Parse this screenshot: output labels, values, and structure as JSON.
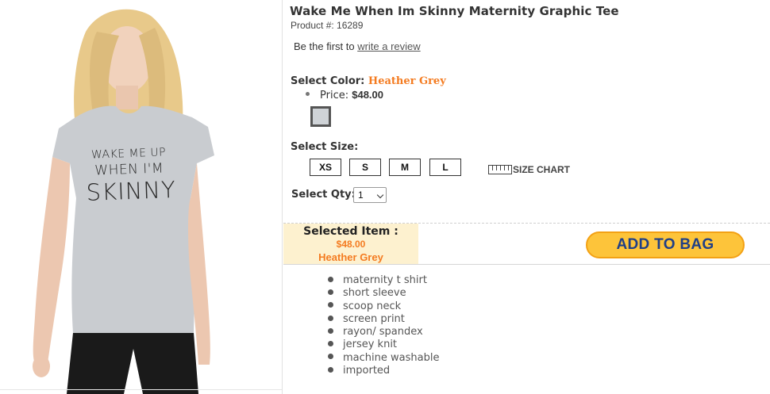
{
  "product": {
    "title": "Wake Me When Im Skinny Maternity Graphic Tee",
    "product_number": "Product #: 16289"
  },
  "review": {
    "prefix": "Be the first to ",
    "link_label": "write a review"
  },
  "color": {
    "label": "Select Color: ",
    "selected": "Heather Grey",
    "swatch_color": "#cfd3d7"
  },
  "price": {
    "label": "Price: ",
    "value": "$48.00"
  },
  "size": {
    "label": "Select Size:",
    "options": [
      "XS",
      "S",
      "M",
      "L"
    ],
    "chart_label": "SIZE CHART"
  },
  "quantity": {
    "label": "Select Qty:",
    "value": "1"
  },
  "selected_item": {
    "label": "Selected Item :",
    "price": "$48.00",
    "color": "Heather Grey"
  },
  "cart": {
    "add_label": "ADD TO BAG"
  },
  "tee_print": [
    "WAKE ME UP",
    "WHEN I'M",
    "SKINNY"
  ],
  "features": [
    "maternity t shirt",
    "short sleeve",
    "scoop neck",
    "screen print",
    "rayon/ spandex",
    "jersey knit",
    "machine washable",
    "imported"
  ],
  "colors": {
    "accent": "#f47b20",
    "button_fill": "#fdc43a",
    "button_text": "#1f3f87",
    "selected_bg": "#fdf1cf"
  }
}
